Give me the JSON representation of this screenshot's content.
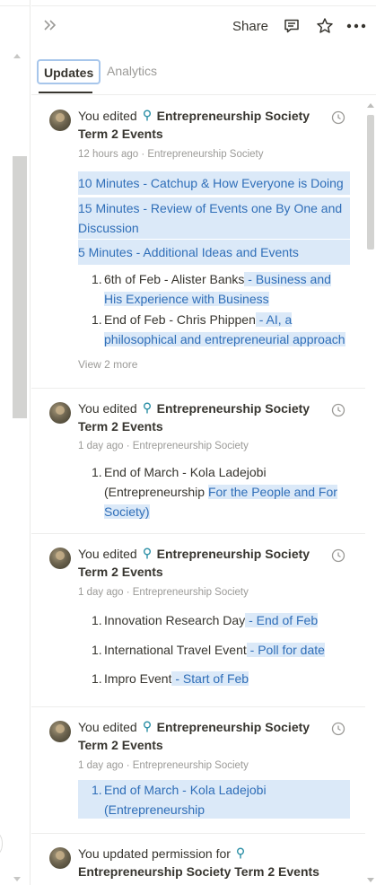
{
  "topbar": {
    "share_label": "Share"
  },
  "tabs": {
    "updates": "Updates",
    "analytics": "Analytics"
  },
  "colors": {
    "highlight_bg": "#dbe9f8",
    "highlight_text": "#2f6eb8",
    "accent_border": "#a7c6eb"
  },
  "icons": {
    "collapse": "double-chevron-right-icon",
    "comment": "comment-icon",
    "favorite": "star-icon",
    "more": "more-horizontal-icon",
    "page": "lightbulb-icon",
    "time": "clock-icon"
  },
  "feed": [
    {
      "actor": "You edited",
      "page": "Entrepreneurship Society Term 2 Events",
      "time": "12 hours ago",
      "workspace": "Entrepreneurship Society",
      "lines": [
        "10 Minutes - Catchup & How Everyone is Doing",
        "15 Minutes - Review of Events one By One and Discussion",
        "5 Minutes - Additional Ideas and Events"
      ],
      "items": [
        {
          "num": "1.",
          "plain": "6th of Feb - Alister Banks",
          "added": " - Business and His Experience with Business"
        },
        {
          "num": "1.",
          "plain": "End of Feb - Chris Phippen",
          "added": " - AI, a philosophical and entrepreneurial approach"
        }
      ],
      "view_more": "View 2 more"
    },
    {
      "actor": "You edited",
      "page": "Entrepreneurship Society Term 2 Events",
      "time": "1 day ago",
      "workspace": "Entrepreneurship Society",
      "items": [
        {
          "num": "1.",
          "plain": "End of March - Kola Ladejobi (Entrepreneurship ",
          "added": "For the People and For Society)"
        }
      ]
    },
    {
      "actor": "You edited",
      "page": "Entrepreneurship Society Term 2 Events",
      "time": "1 day ago",
      "workspace": "Entrepreneurship Society",
      "items": [
        {
          "num": "1.",
          "plain": "Innovation Research Day",
          "added": " - End of Feb"
        },
        {
          "num": "1.",
          "plain": "International Travel Event",
          "added": " - Poll for date"
        },
        {
          "num": "1.",
          "plain": "Impro Event",
          "added": " - Start of Feb"
        }
      ]
    },
    {
      "actor": "You edited",
      "page": "Entrepreneurship Society Term 2 Events",
      "time": "1 day ago",
      "workspace": "Entrepreneurship Society",
      "items": [
        {
          "num": "1.",
          "plain": "End of March - Kola Ladejobi (Entrepreneurship",
          "added": ""
        }
      ]
    },
    {
      "actor": "You updated permission for",
      "page": "Entrepreneurship Society Term 2 Events"
    }
  ]
}
